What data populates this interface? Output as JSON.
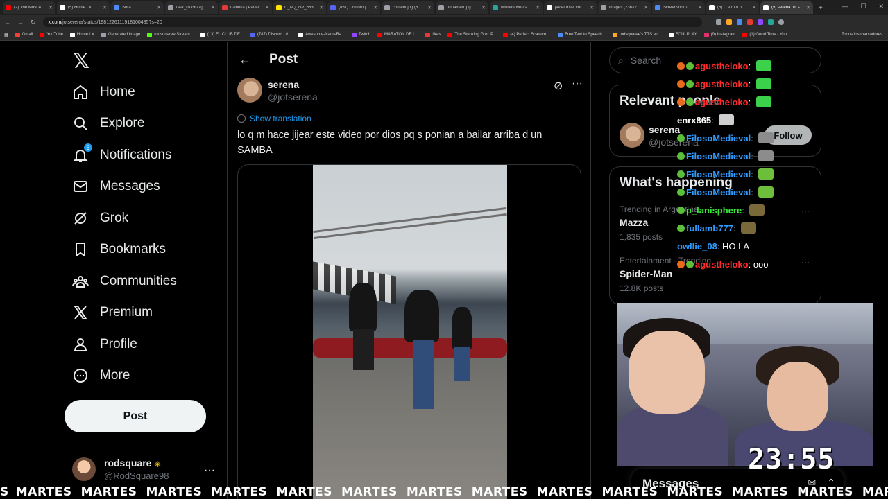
{
  "browser": {
    "tabs": [
      {
        "label": "(2) The Most A",
        "color": "#ff0000"
      },
      {
        "label": "(5) Home / X",
        "color": "#ffffff"
      },
      {
        "label": "Sora",
        "color": "#4c8bf5"
      },
      {
        "label": "task_01k9tz7g",
        "color": "#9aa0a6"
      },
      {
        "label": "Ceneka | Panel",
        "color": "#e53935"
      },
      {
        "label": "D_NQ_NP_663",
        "color": "#ffe600"
      },
      {
        "label": "(851) Discord |",
        "color": "#5865f2"
      },
      {
        "label": "content.jpg (6",
        "color": "#9aa0a6"
      },
      {
        "label": "unnamed.jpg",
        "color": "#9aa0a6"
      },
      {
        "label": "wmremove-tra",
        "color": "#26a69a"
      },
      {
        "label": "javier milei cui",
        "color": "#ffffff"
      },
      {
        "label": "images (236×2",
        "color": "#9aa0a6"
      },
      {
        "label": "Screenshot 1",
        "color": "#4c8bf5"
      },
      {
        "label": "(5) D e m o n",
        "color": "#ffffff"
      },
      {
        "label": "(5) serena on X",
        "color": "#ffffff",
        "active": true
      }
    ],
    "url_host": "x.com",
    "url_path": "/jotserena/status/1981226111918100485?s=20",
    "bookmarks": [
      {
        "label": "Gmail",
        "color": "#ea4335"
      },
      {
        "label": "YouTube",
        "color": "#ff0000"
      },
      {
        "label": "Home / X",
        "color": "#ffffff"
      },
      {
        "label": "Generated image",
        "color": "#9aa0a6"
      },
      {
        "label": "rodsquaree Stream...",
        "color": "#53fc18"
      },
      {
        "label": "(13) EL CLUB DE...",
        "color": "#ffffff"
      },
      {
        "label": "(787) Discord | #...",
        "color": "#5865f2"
      },
      {
        "label": "Awesome-Nano-Ba...",
        "color": "#ffffff"
      },
      {
        "label": "Twitch",
        "color": "#9146ff"
      },
      {
        "label": "MARATON DE L...",
        "color": "#ff0000"
      },
      {
        "label": "likes",
        "color": "#e53935"
      },
      {
        "label": "The Smoking Gun: P...",
        "color": "#ff0000"
      },
      {
        "label": "(4) Perfect Scarecro...",
        "color": "#ff0000"
      },
      {
        "label": "Free Text to Speech...",
        "color": "#4c8bf5"
      },
      {
        "label": "rodsquaree's TTS Vo...",
        "color": "#ffa726"
      },
      {
        "label": "FOULPLAY",
        "color": "#ffffff"
      },
      {
        "label": "(9) Instagram",
        "color": "#e1306c"
      },
      {
        "label": "(1) Good Time - You...",
        "color": "#ff0000"
      }
    ],
    "bookmarks_right": "Todos los marcadores"
  },
  "nav": {
    "items": [
      {
        "label": "Home",
        "icon": "home-icon"
      },
      {
        "label": "Explore",
        "icon": "search-icon"
      },
      {
        "label": "Notifications",
        "icon": "bell-icon",
        "badge": "5"
      },
      {
        "label": "Messages",
        "icon": "mail-icon"
      },
      {
        "label": "Grok",
        "icon": "grok-icon"
      },
      {
        "label": "Bookmarks",
        "icon": "bookmark-icon"
      },
      {
        "label": "Communities",
        "icon": "communities-icon"
      },
      {
        "label": "Premium",
        "icon": "x-premium-icon"
      },
      {
        "label": "Profile",
        "icon": "person-icon"
      },
      {
        "label": "More",
        "icon": "more-circle-icon"
      }
    ],
    "post_label": "Post",
    "account": {
      "name": "rodsquare",
      "handle": "@RodSquare98"
    }
  },
  "main": {
    "title": "Post",
    "author_name": "serena",
    "author_handle": "@jotserena",
    "translate_label": "Show translation",
    "text": "lo q m hace jijear este video por dios pq s ponian a bailar arriba d un SAMBA"
  },
  "right": {
    "search_placeholder": "Search",
    "relevant_title": "Relevant people",
    "relevant_name": "serena",
    "relevant_handle": "@jotserena",
    "follow_label": "Follow",
    "happening_title": "What's happening",
    "trends": [
      {
        "category": "Trending in Argentina",
        "name": "Mazza",
        "count": "1,835 posts"
      },
      {
        "category": "Entertainment · Trending",
        "name": "Spider-Man",
        "count": "12.8K posts"
      }
    ]
  },
  "chat": [
    {
      "badges": [
        "o",
        "g"
      ],
      "user": "agustheloko",
      "color": "#ff2a2a",
      "text": "",
      "emote": "#3bd14b"
    },
    {
      "badges": [
        "o",
        "g"
      ],
      "user": "agustheloko",
      "color": "#ff2a2a",
      "text": "",
      "emote": "#3bd14b"
    },
    {
      "badges": [
        "o",
        "g"
      ],
      "user": "agustheloko",
      "color": "#ff2a2a",
      "text": "",
      "emote": "#3bd14b"
    },
    {
      "badges": [],
      "user": "enrx865",
      "color": "#ffffff",
      "text": "",
      "emote": "#cfcfcf"
    },
    {
      "badges": [
        "g"
      ],
      "user": "FilosoMedieval",
      "color": "#2f9bff",
      "text": "",
      "emote": "#8c8c8c"
    },
    {
      "badges": [
        "g"
      ],
      "user": "FilosoMedieval",
      "color": "#2f9bff",
      "text": "",
      "emote": "#8c8c8c"
    },
    {
      "badges": [
        "g"
      ],
      "user": "FilosoMedieval",
      "color": "#2f9bff",
      "text": "",
      "emote": "#6dbe3a"
    },
    {
      "badges": [
        "g"
      ],
      "user": "FilosoMedieval",
      "color": "#2f9bff",
      "text": "",
      "emote": "#6dbe3a"
    },
    {
      "badges": [
        "g"
      ],
      "user": "p_lanisphere",
      "color": "#39e639",
      "text": "",
      "emote": "#7a6a3a"
    },
    {
      "badges": [
        "g"
      ],
      "user": "fullamb777",
      "color": "#2f9bff",
      "text": "",
      "emote": "#7a6a3a"
    },
    {
      "badges": [],
      "user": "owllie_08",
      "color": "#2f9bff",
      "text": "HO LA",
      "emote": ""
    },
    {
      "badges": [
        "o",
        "g"
      ],
      "user": "agustheloko",
      "color": "#ff2a2a",
      "text": "ooo",
      "emote": ""
    }
  ],
  "stream": {
    "timer": "23:55",
    "ticker_word": "MARTES",
    "ticker_start": "S"
  },
  "messages_drawer": {
    "title": "Messages"
  }
}
